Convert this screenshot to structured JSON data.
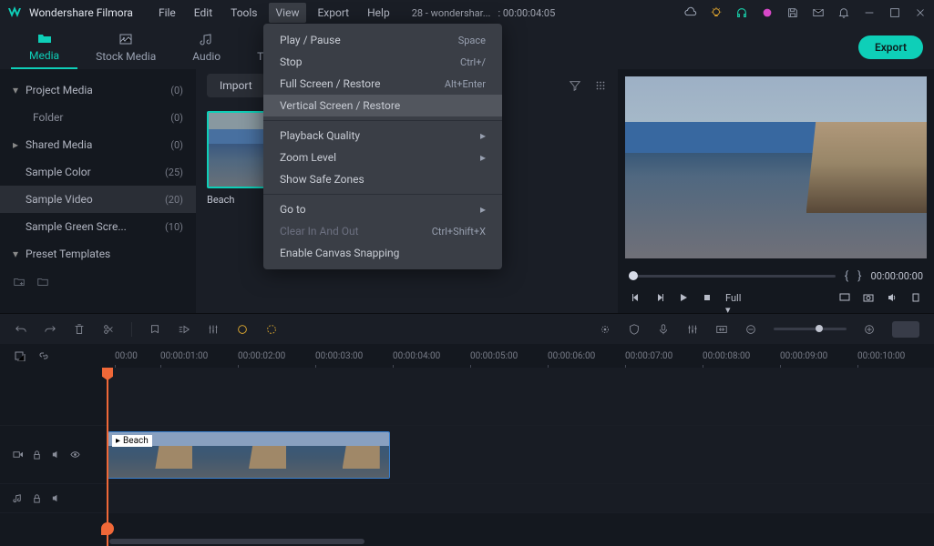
{
  "app": {
    "title": "Wondershare Filmora"
  },
  "menu": [
    "File",
    "Edit",
    "Tools",
    "View",
    "Export",
    "Help"
  ],
  "project": {
    "name": "28 - wondershar...",
    "time": ": 00:00:04:05"
  },
  "tabs": [
    {
      "label": "Media"
    },
    {
      "label": "Stock Media"
    },
    {
      "label": "Audio"
    },
    {
      "label": "Titles"
    }
  ],
  "export_label": "Export",
  "sidebar": [
    {
      "label": "Project Media",
      "count": "(0)",
      "chev": "▾"
    },
    {
      "label": "Folder",
      "count": "(0)",
      "indent": true
    },
    {
      "label": "Shared Media",
      "count": "(0)",
      "chev": "▸"
    },
    {
      "label": "Sample Color",
      "count": "(25)"
    },
    {
      "label": "Sample Video",
      "count": "(20)",
      "selected": true
    },
    {
      "label": "Sample Green Scre...",
      "count": "(10)"
    },
    {
      "label": "Preset Templates",
      "chev": "▾"
    }
  ],
  "import_label": "Import",
  "thumbs": [
    {
      "label": "Beach"
    },
    {
      "label": ""
    }
  ],
  "preview": {
    "brace_open": "{",
    "brace_close": "}",
    "time": "00:00:00:00",
    "full": "Full"
  },
  "ruler": [
    "00:00",
    "00:00:01:00",
    "00:00:02:00",
    "00:00:03:00",
    "00:00:04:00",
    "00:00:05:00",
    "00:00:06:00",
    "00:00:07:00",
    "00:00:08:00",
    "00:00:09:00",
    "00:00:10:00"
  ],
  "tracks": {
    "video": "",
    "audio": ""
  },
  "clip": {
    "label": "Beach"
  },
  "dropdown": [
    {
      "label": "Play / Pause",
      "sc": "Space"
    },
    {
      "label": "Stop",
      "sc": "Ctrl+/"
    },
    {
      "label": "Full Screen / Restore",
      "sc": "Alt+Enter"
    },
    {
      "label": "Vertical Screen / Restore",
      "hl": true
    },
    {
      "sep": true
    },
    {
      "label": "Playback Quality",
      "sub": true
    },
    {
      "label": "Zoom Level",
      "sub": true
    },
    {
      "label": "Show Safe Zones"
    },
    {
      "sep": true
    },
    {
      "label": "Go to",
      "sub": true
    },
    {
      "label": "Clear In And Out",
      "sc": "Ctrl+Shift+X",
      "disabled": true
    },
    {
      "label": "Enable Canvas Snapping"
    }
  ]
}
